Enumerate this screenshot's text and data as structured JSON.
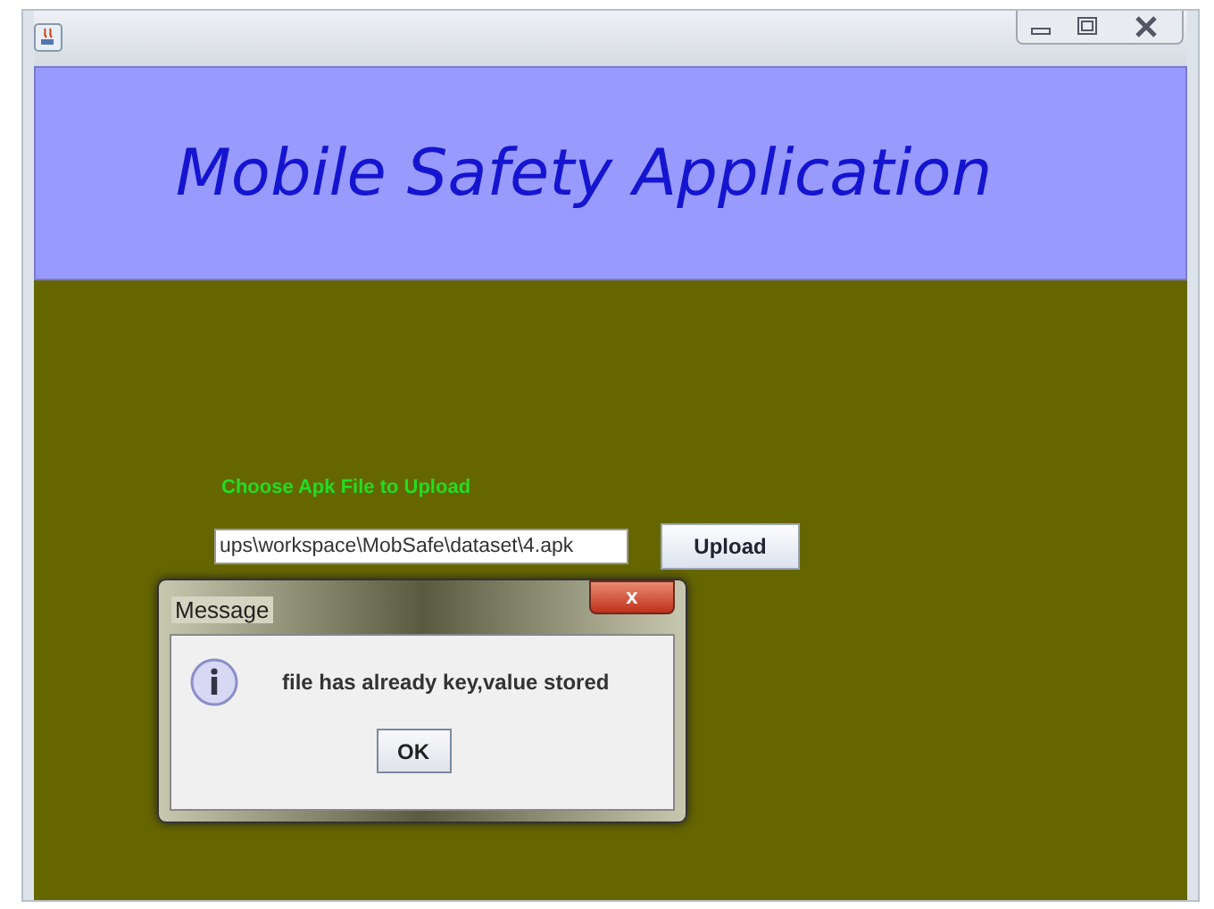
{
  "window": {
    "title_buttons": [
      {
        "kind": "minimize"
      },
      {
        "kind": "maximize"
      },
      {
        "kind": "close"
      }
    ]
  },
  "header": {
    "title": "Mobile Safety Application"
  },
  "upload": {
    "label": "Choose Apk File to Upload",
    "value": "ups\\workspace\\MobSafe\\dataset\\4.apk",
    "button": "Upload"
  },
  "dialog": {
    "title": "Message",
    "close": "x",
    "message": "file has already key,value stored",
    "button": "OK"
  }
}
